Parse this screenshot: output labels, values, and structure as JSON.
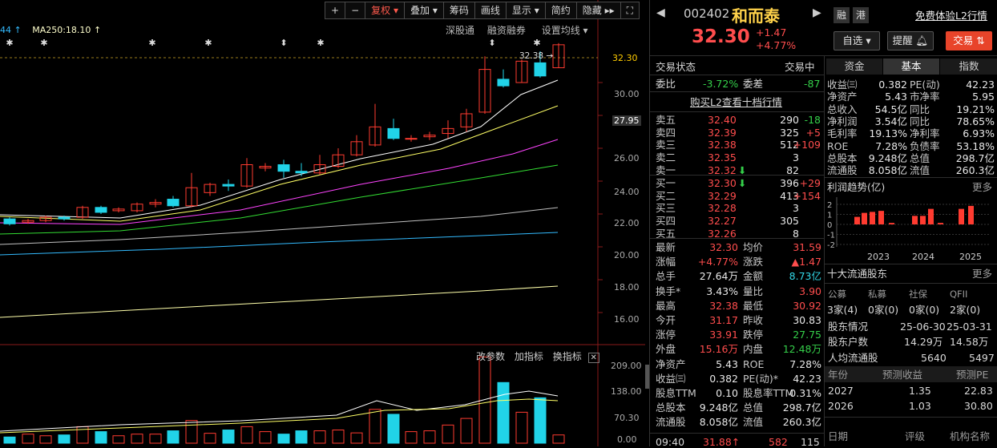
{
  "toolbar": {
    "items": [
      "+",
      "−",
      "复权",
      "叠加",
      "筹码",
      "画线",
      "显示",
      "简约",
      "隐藏",
      "",
      "⛶"
    ]
  },
  "ma_legend": {
    "ma_partial": "44",
    "ma250": "MA250:18.10"
  },
  "chart_links": {
    "shengu": "深股通",
    "rongzi": "融资融券",
    "setma": "设置均线"
  },
  "price_axis": {
    "ticks": [
      "32.30",
      "30.00",
      "27.95",
      "26.00",
      "24.00",
      "22.00",
      "20.00",
      "18.00",
      "16.00"
    ],
    "last": "32.30",
    "cursor": "27.95",
    "hi_label": "32.38"
  },
  "vol_links": {
    "change": "改参数",
    "add": "加指标",
    "switch": "换指标"
  },
  "vol_axis": {
    "ticks": [
      "209.00",
      "138.00",
      "70.30",
      "0.00"
    ]
  },
  "colors": {
    "up": "#ff3b30",
    "down": "#21d3e8",
    "bg": "#000000",
    "ma5": "#ffffff",
    "ma10": "#ffff66",
    "ma20": "#ff44ff",
    "ma30": "#33dd33",
    "ma60": "#c0c0c0",
    "ma120": "#33bbff",
    "ma250": "#ffffaa"
  },
  "header": {
    "code": "002402",
    "name": "和而泰",
    "tag1": "融",
    "tag2": "港",
    "l2": "免费体验L2行情",
    "price": "32.30",
    "chg": "+1.47",
    "pct": "+4.77%",
    "btn_fav": "自选",
    "btn_alert": "提醒",
    "btn_trade": "交易"
  },
  "status": {
    "label": "交易状态",
    "value": "交易中",
    "weibi_l": "委比",
    "weibi": "-3.72%",
    "weicha_l": "委差",
    "weicha": "-87",
    "buyl2": "购买L2查看十档行情"
  },
  "sells": [
    {
      "n": "卖五",
      "p": "32.40",
      "v": "290",
      "d": "-18"
    },
    {
      "n": "卖四",
      "p": "32.39",
      "v": "325",
      "d": "+5"
    },
    {
      "n": "卖三",
      "p": "32.38",
      "v": "512",
      "d": "+109"
    },
    {
      "n": "卖二",
      "p": "32.35",
      "v": "3",
      "d": ""
    },
    {
      "n": "卖一",
      "p": "32.32",
      "v": "82",
      "d": ""
    }
  ],
  "buys": [
    {
      "n": "买一",
      "p": "32.30",
      "v": "396",
      "d": "+29"
    },
    {
      "n": "买二",
      "p": "32.29",
      "v": "413",
      "d": "+154"
    },
    {
      "n": "买三",
      "p": "32.28",
      "v": "3",
      "d": ""
    },
    {
      "n": "买四",
      "p": "32.27",
      "v": "305",
      "d": ""
    },
    {
      "n": "买五",
      "p": "32.26",
      "v": "8",
      "d": ""
    }
  ],
  "stats": [
    {
      "l1": "最新",
      "v1": "32.30",
      "c1": "red",
      "l2": "均价",
      "v2": "31.59",
      "c2": "red"
    },
    {
      "l1": "涨幅",
      "v1": "+4.77%",
      "c1": "red",
      "l2": "涨跌",
      "v2": "▲1.47",
      "c2": "red"
    },
    {
      "l1": "总手",
      "v1": "27.64万",
      "c1": "white",
      "l2": "金额",
      "v2": "8.73亿",
      "c2": "cyan"
    },
    {
      "l1": "换手*",
      "v1": "3.43%",
      "c1": "white",
      "l2": "量比",
      "v2": "3.90",
      "c2": "red"
    },
    {
      "l1": "最高",
      "v1": "32.38",
      "c1": "red",
      "l2": "最低",
      "v2": "30.92",
      "c2": "red"
    },
    {
      "l1": "今开",
      "v1": "31.17",
      "c1": "red",
      "l2": "昨收",
      "v2": "30.83",
      "c2": "white"
    },
    {
      "l1": "涨停",
      "v1": "33.91",
      "c1": "red",
      "l2": "跌停",
      "v2": "27.75",
      "c2": "green"
    },
    {
      "l1": "外盘",
      "v1": "15.16万",
      "c1": "red",
      "l2": "内盘",
      "v2": "12.48万",
      "c2": "green"
    },
    {
      "l1": "净资产",
      "v1": "5.43",
      "c1": "white",
      "l2": "ROE",
      "v2": "7.28%",
      "c2": "white"
    },
    {
      "l1": "收益㈢",
      "v1": "0.382",
      "c1": "white",
      "l2": "PE(动)*",
      "v2": "42.23",
      "c2": "white"
    },
    {
      "l1": "股息TTM",
      "v1": "0.10",
      "c1": "white",
      "l2": "股息率TTM",
      "v2": "0.31%",
      "c2": "white"
    },
    {
      "l1": "总股本",
      "v1": "9.248亿",
      "c1": "white",
      "l2": "总值",
      "v2": "298.7亿",
      "c2": "white"
    },
    {
      "l1": "流通股",
      "v1": "8.058亿",
      "c1": "white",
      "l2": "流值",
      "v2": "260.3亿",
      "c2": "white"
    }
  ],
  "tick": {
    "time": "09:40",
    "price": "31.88↑",
    "vol": "582",
    "n": "115"
  },
  "tabs": [
    "资金",
    "基本",
    "指数"
  ],
  "basic": [
    {
      "l1": "收益㈢",
      "v1": "0.382",
      "l2": "PE(动)",
      "v2": "42.23"
    },
    {
      "l1": "净资产",
      "v1": "5.43",
      "l2": "市净率",
      "v2": "5.95"
    },
    {
      "l1": "总收入",
      "v1": "54.5亿",
      "l2": "同比",
      "v2": "19.21%"
    },
    {
      "l1": "净利润",
      "v1": "3.54亿",
      "l2": "同比",
      "v2": "78.65%"
    },
    {
      "l1": "毛利率",
      "v1": "19.13%",
      "l2": "净利率",
      "v2": "6.93%"
    },
    {
      "l1": "ROE",
      "v1": "7.28%",
      "l2": "负债率",
      "v2": "53.18%"
    },
    {
      "l1": "总股本",
      "v1": "9.248亿",
      "l2": "总值",
      "v2": "298.7亿"
    },
    {
      "l1": "流通股",
      "v1": "8.058亿",
      "l2": "流值",
      "v2": "260.3亿"
    }
  ],
  "profit": {
    "title": "利润趋势(亿)",
    "more": "更多",
    "yticks": [
      "2",
      "1",
      "0",
      "-1",
      "-2"
    ],
    "years": [
      "2023",
      "2024",
      "2025"
    ],
    "bars": [
      0.75,
      1.15,
      1.25,
      1.35,
      0.15,
      0.85,
      0.85,
      1.55,
      0.15,
      1.55,
      1.85
    ]
  },
  "holders": {
    "title": "十大流通股东",
    "more": "更多",
    "cats": [
      "公募",
      "私募",
      "社保",
      "QFII"
    ],
    "counts": [
      "3家(4)",
      "0家(0)",
      "0家(0)",
      "2家(0)"
    ],
    "dates_l": "股东情况",
    "d1": "25-06-30",
    "d2": "25-03-31",
    "hu_l": "股东户数",
    "hu1": "14.29万",
    "hu2": "14.58万",
    "avg_l": "人均流通股",
    "avg1": "5640",
    "avg2": "5497"
  },
  "forecast": {
    "h1": "年份",
    "h2": "预测收益",
    "h3": "预测PE",
    "rows": [
      {
        "y": "2027",
        "e": "1.35",
        "pe": "22.83"
      },
      {
        "y": "2026",
        "e": "1.03",
        "pe": "30.80"
      }
    ],
    "f1": "日期",
    "f2": "评级",
    "f3": "机构名称"
  }
}
